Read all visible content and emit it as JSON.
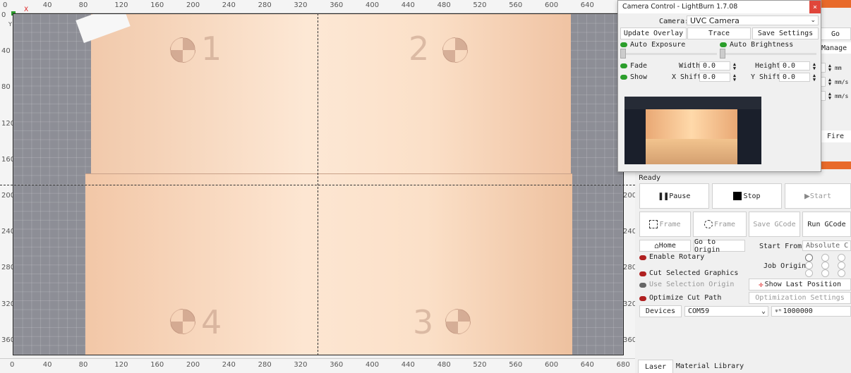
{
  "ruler": {
    "top_ticks": [
      "0",
      "40",
      "80",
      "120",
      "160",
      "200",
      "240",
      "280",
      "320",
      "360",
      "400",
      "440",
      "480",
      "520",
      "560",
      "600",
      "640"
    ],
    "bottom_ticks": [
      "0",
      "40",
      "80",
      "120",
      "160",
      "200",
      "240",
      "280",
      "320",
      "360",
      "400",
      "440",
      "480",
      "520",
      "560",
      "600",
      "640",
      "680"
    ],
    "left_ticks": [
      "0",
      "40",
      "80",
      "120",
      "160",
      "200",
      "240",
      "280",
      "320",
      "360"
    ],
    "right_ticks": [
      "200",
      "240",
      "280",
      "320",
      "360"
    ],
    "x_label": "X",
    "y_label": "Y"
  },
  "canvas": {
    "markers": [
      "1",
      "2",
      "3",
      "4"
    ]
  },
  "camera_dialog": {
    "title": "Camera Control - LightBurn 1.7.08",
    "close": "×",
    "camera_label": "Camera:",
    "camera_value": "UVC Camera",
    "buttons": {
      "update_overlay": "Update Overlay",
      "trace": "Trace",
      "save_settings": "Save Settings"
    },
    "auto_exposure": "Auto Exposure",
    "auto_brightness": "Auto Brightness",
    "fade": "Fade",
    "show": "Show",
    "width_label": "Width",
    "width_value": "0.0",
    "height_label": "Height",
    "height_value": "0.0",
    "xshift_label": "X Shift",
    "xshift_value": "0.0",
    "yshift_label": "Y Shift",
    "yshift_value": "0.0"
  },
  "right_panel": {
    "go": "Go",
    "manage": "Manage",
    "units": [
      "mm",
      "mm/s",
      "mm/s"
    ],
    "fire": "Fire",
    "colon": ":",
    "status": "Ready",
    "pause": "Pause",
    "stop": "Stop",
    "start": "Start",
    "frame1": "Frame",
    "frame2": "Frame",
    "save_gcode": "Save GCode",
    "run_gcode": "Run GCode",
    "home": "Home",
    "go_to_origin": "Go to Origin",
    "start_from_label": "Start From:",
    "start_from_value": "Absolute C",
    "enable_rotary": "Enable Rotary",
    "job_origin": "Job Origin",
    "cut_selected": "Cut Selected Graphics",
    "use_selection_origin": "Use Selection Origin",
    "show_last_position": "Show Last Position",
    "optimize_cut_path": "Optimize Cut Path",
    "optimization_settings": "Optimization Settings",
    "devices": "Devices",
    "port": "COM59",
    "baud": "1000000",
    "tab_laser": "Laser",
    "tab_material": "Material Library"
  }
}
